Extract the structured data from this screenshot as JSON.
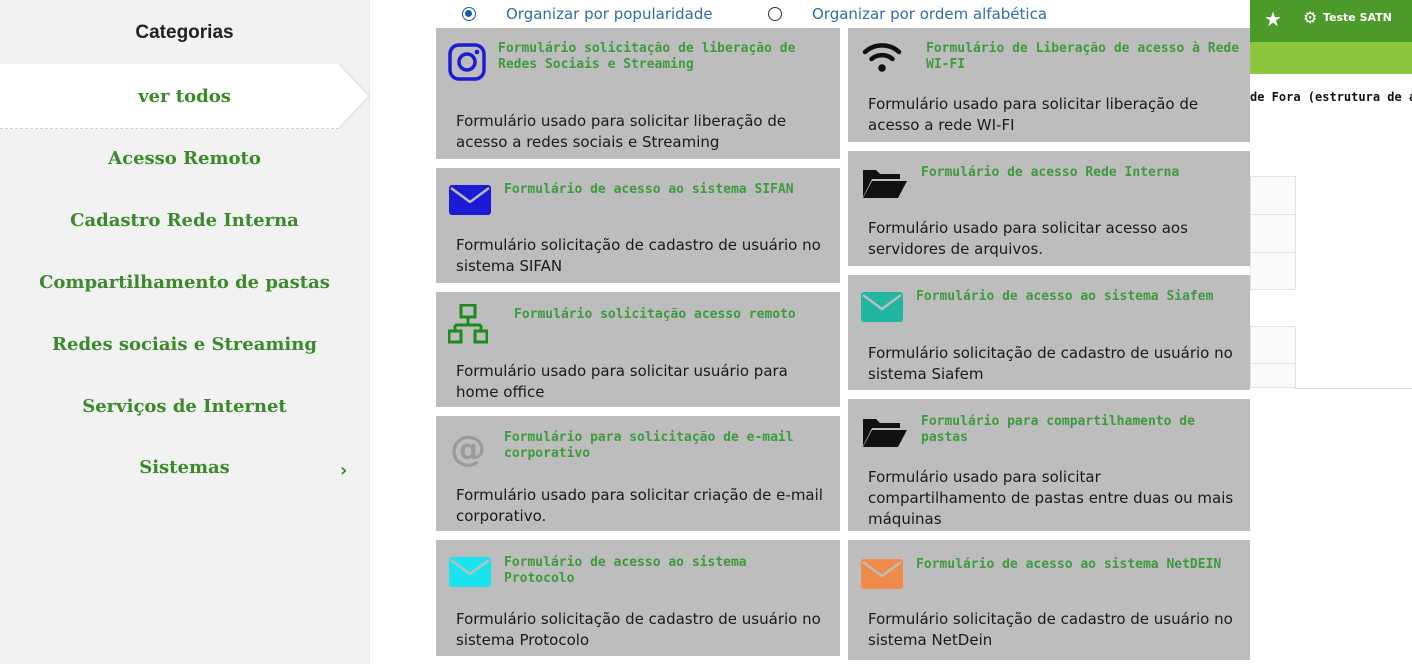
{
  "header": {
    "user_name": "Teste SATN",
    "star_icon": "star-icon",
    "gear_icon": "gear-icon"
  },
  "background": {
    "partial_text": "de Fora (estrutura de á"
  },
  "sidebar": {
    "title": "Categorias",
    "active": "ver todos",
    "items": [
      {
        "label": "ver todos"
      },
      {
        "label": "Acesso Remoto"
      },
      {
        "label": "Cadastro Rede Interna"
      },
      {
        "label": "Compartilhamento de pastas"
      },
      {
        "label": "Redes sociais e Streaming"
      },
      {
        "label": "Serviços de Internet"
      },
      {
        "label": "Sistemas"
      }
    ],
    "chevron": "›"
  },
  "sort": {
    "options": [
      {
        "label": "Organizar por popularidade",
        "checked": true
      },
      {
        "label": "Organizar por ordem alfabética",
        "checked": false
      }
    ]
  },
  "colors": {
    "green_text": "#3d9a3d",
    "sidebar_green": "#3a8a2a",
    "card_bg": "#bdbdbd",
    "link_blue": "#2f6da8",
    "header_green": "#4c9a2a"
  },
  "cards": {
    "left": [
      {
        "title": "Formulário solicitação de liberação de Redes Sociais e Streaming",
        "description": "Formulário usado para solicitar liberação de acesso a redes sociais e Streaming",
        "icon": "instagram-icon"
      },
      {
        "title": "Formulário de acesso ao sistema SIFAN",
        "description": "Formulário solicitação de cadastro de usuário no sistema SIFAN",
        "icon": "envelope-icon"
      },
      {
        "title": "Formulário solicitação acesso remoto",
        "description": "Formulário usado para solicitar usuário para home office",
        "icon": "network-icon"
      },
      {
        "title": "Formulário para solicitação de e-mail corporativo",
        "description": "Formulário usado para solicitar criação de e-mail corporativo.",
        "icon": "at-sign-icon"
      },
      {
        "title": "Formulário de acesso ao sistema Protocolo",
        "description": "Formulário solicitação de cadastro de usuário no sistema Protocolo",
        "icon": "envelope-icon"
      }
    ],
    "right": [
      {
        "title": "Formulário de Liberação de acesso à Rede WI-FI",
        "description": "Formulário usado para solicitar liberação de acesso a rede WI-FI",
        "icon": "wifi-icon"
      },
      {
        "title": "Formulário de acesso Rede Interna",
        "description": "Formulário usado para solicitar acesso aos servidores de arquivos.",
        "icon": "folder-open-icon"
      },
      {
        "title": "Formulário de acesso ao sistema Siafem",
        "description": "Formulário solicitação de cadastro de usuário no sistema Siafem",
        "icon": "envelope-icon"
      },
      {
        "title": "Formulário para compartilhamento de pastas",
        "description": "Formulário usado para solicitar compartilhamento de pastas entre duas ou mais máquinas",
        "icon": "folder-open-icon"
      },
      {
        "title": "Formulário de acesso ao sistema NetDEIN",
        "description": "Formulário solicitação de cadastro de usuário no sistema NetDein",
        "icon": "envelope-icon"
      }
    ]
  }
}
